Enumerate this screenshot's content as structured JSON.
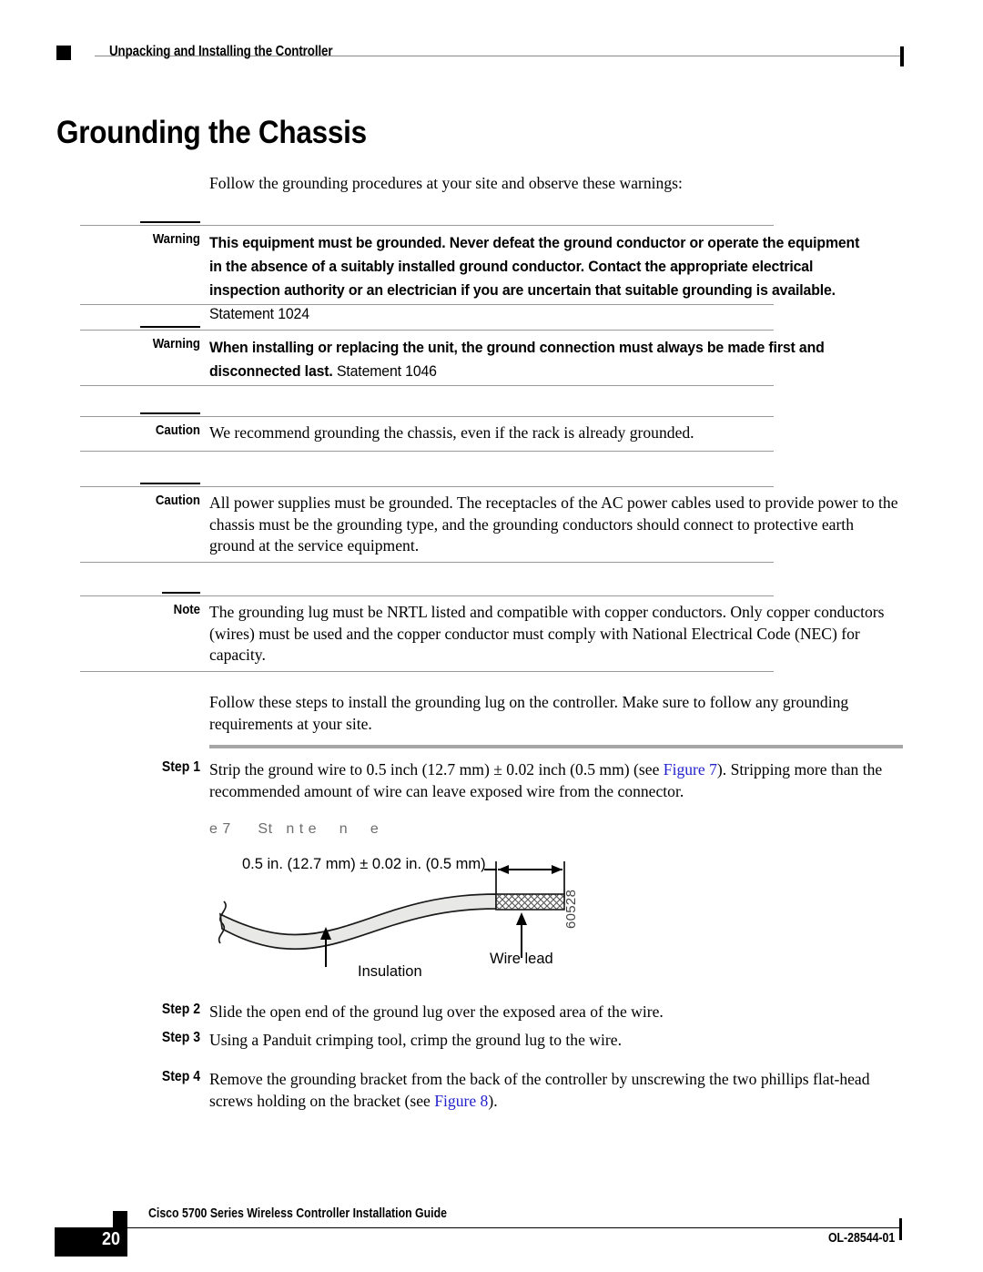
{
  "header": {
    "chapter_title": "Unpacking and Installing the Controller"
  },
  "heading": "Grounding the Chassis",
  "intro_paragraph": "Follow the grounding procedures at your site and observe these warnings:",
  "admonitions": [
    {
      "label": "Warning",
      "bold_text": "This equipment must be grounded. Never defeat the ground conductor or operate the equipment in the absence of a suitably installed ground conductor. Contact the appropriate electrical inspection authority or an electrician if you are uncertain that suitable grounding is available.",
      "statement": "Statement 1024"
    },
    {
      "label": "Warning",
      "bold_text": "When installing or replacing the unit, the ground connection must always be made first and disconnected last.",
      "statement": "Statement 1046"
    },
    {
      "label": "Caution",
      "text": "We recommend grounding the chassis, even if the rack is already grounded."
    },
    {
      "label": "Caution",
      "text": "All power supplies must be grounded. The receptacles of the AC power cables used to provide power to the chassis must be the grounding type, and the grounding conductors should connect to protective earth ground at the service equipment."
    },
    {
      "label": "Note",
      "text": "The grounding lug must be NRTL listed and compatible with copper conductors. Only copper conductors (wires) must be used and the copper conductor must comply with National Electrical Code (NEC) for capacity."
    }
  ],
  "steps_intro": "Follow these steps to install the grounding lug on the controller. Make sure to follow any grounding requirements at your site.",
  "steps": [
    {
      "label": "Step 1",
      "text_before_link": "Strip the ground wire to 0.5 inch (12.7 mm) ± 0.02 inch (0.5 mm) (see ",
      "link": "Figure 7",
      "text_after_link": "). Stripping more than the recommended amount of wire can leave exposed wire from the connector."
    },
    {
      "label": "Step 2",
      "text": "Slide the open end of the ground lug over the exposed area of the wire."
    },
    {
      "label": "Step 3",
      "text": "Using a Panduit crimping tool, crimp the ground lug to the wire."
    },
    {
      "label": "Step 4",
      "text_before_link": "Remove the grounding bracket from the back of the controller by unscrewing the two phillips flat-head screws holding on the bracket (see ",
      "link": "Figure 8",
      "text_after_link": ")."
    }
  ],
  "figure": {
    "caption_fragments": "e 7      St   n t e     n     e",
    "dimension_label": "0.5 in. (12.7 mm) ± 0.02 in. (0.5 mm)",
    "callout_insulation": "Insulation",
    "callout_wire_lead": "Wire lead",
    "art_number": "60528"
  },
  "footer": {
    "page_number": "20",
    "guide_title": "Cisco 5700 Series Wireless Controller Installation Guide",
    "doc_id": "OL-28544-01"
  },
  "colors": {
    "link": "#2222cc",
    "rule_gray": "#9a9a9a",
    "step_rule_gray": "#a6a6a6",
    "insulation_fill": "#e8e8e6"
  }
}
